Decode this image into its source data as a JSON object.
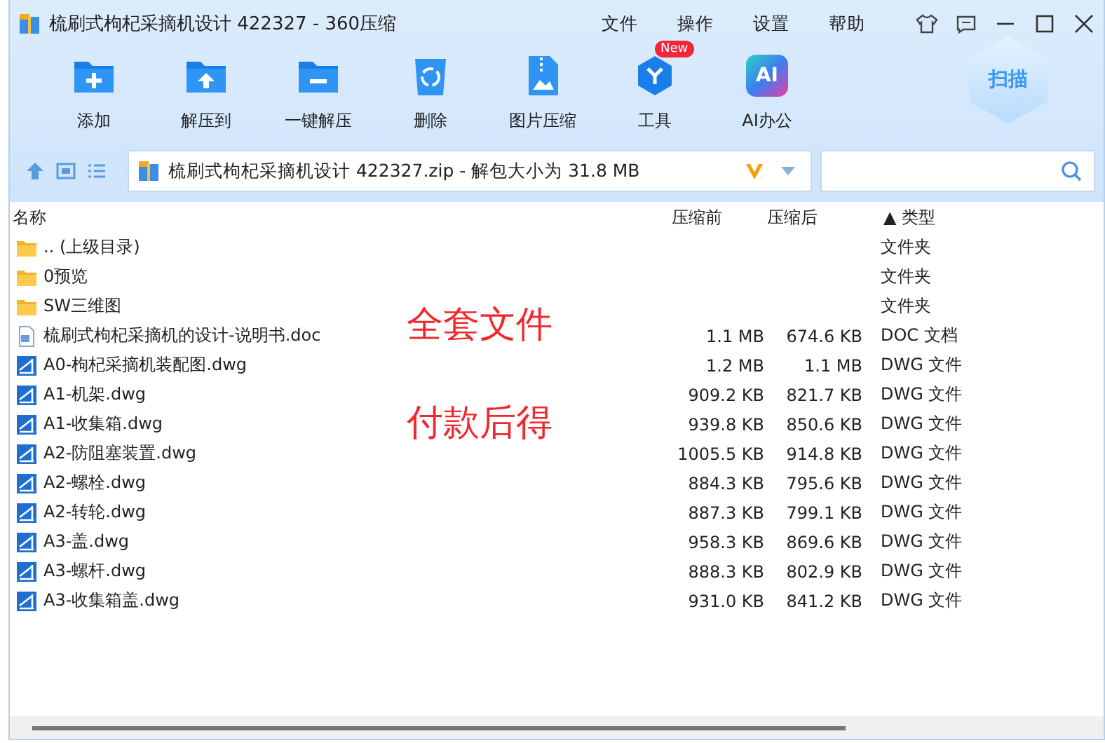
{
  "window": {
    "title": "梳刷式枸杞采摘机设计 422327 - 360压缩"
  },
  "menu": [
    "文件",
    "操作",
    "设置",
    "帮助"
  ],
  "toolbar": [
    {
      "label": "添加",
      "kind": "add"
    },
    {
      "label": "解压到",
      "kind": "extract"
    },
    {
      "label": "一键解压",
      "kind": "oneclick"
    },
    {
      "label": "删除",
      "kind": "delete"
    },
    {
      "label": "图片压缩",
      "kind": "image"
    },
    {
      "label": "工具",
      "kind": "tools",
      "badge": "New"
    },
    {
      "label": "AI办公",
      "kind": "ai",
      "icon_text": "AI"
    }
  ],
  "scan_button": "扫描",
  "address": {
    "path": "梳刷式枸杞采摘机设计 422327.zip - 解包大小为 31.8 MB"
  },
  "table": {
    "columns": [
      {
        "label": "名称"
      },
      {
        "label": "压缩前"
      },
      {
        "label": "压缩后"
      },
      {
        "label": "类型",
        "sort_mark": "▲"
      }
    ],
    "rows": [
      {
        "kind": "folder",
        "name": ".. (上级目录)",
        "before": "",
        "after": "",
        "type": "文件夹"
      },
      {
        "kind": "folder",
        "name": "0预览",
        "before": "",
        "after": "",
        "type": "文件夹"
      },
      {
        "kind": "folder",
        "name": "SW三维图",
        "before": "",
        "after": "",
        "type": "文件夹"
      },
      {
        "kind": "doc",
        "name": "梳刷式枸杞采摘机的设计-说明书.doc",
        "before": "1.1 MB",
        "after": "674.6 KB",
        "type": "DOC 文档"
      },
      {
        "kind": "dwg",
        "name": "A0-枸杞采摘机装配图.dwg",
        "before": "1.2 MB",
        "after": "1.1 MB",
        "type": "DWG 文件"
      },
      {
        "kind": "dwg",
        "name": "A1-机架.dwg",
        "before": "909.2 KB",
        "after": "821.7 KB",
        "type": "DWG 文件"
      },
      {
        "kind": "dwg",
        "name": "A1-收集箱.dwg",
        "before": "939.8 KB",
        "after": "850.6 KB",
        "type": "DWG 文件"
      },
      {
        "kind": "dwg",
        "name": "A2-防阻塞装置.dwg",
        "before": "1005.5 KB",
        "after": "914.8 KB",
        "type": "DWG 文件"
      },
      {
        "kind": "dwg",
        "name": "A2-螺栓.dwg",
        "before": "884.3 KB",
        "after": "795.6 KB",
        "type": "DWG 文件"
      },
      {
        "kind": "dwg",
        "name": "A2-转轮.dwg",
        "before": "887.3 KB",
        "after": "799.1 KB",
        "type": "DWG 文件"
      },
      {
        "kind": "dwg",
        "name": "A3-盖.dwg",
        "before": "958.3 KB",
        "after": "869.6 KB",
        "type": "DWG 文件"
      },
      {
        "kind": "dwg",
        "name": "A3-螺杆.dwg",
        "before": "888.3 KB",
        "after": "802.9 KB",
        "type": "DWG 文件"
      },
      {
        "kind": "dwg",
        "name": "A3-收集箱盖.dwg",
        "before": "931.0 KB",
        "after": "841.2 KB",
        "type": "DWG 文件"
      }
    ]
  },
  "overlay_texts": [
    "全套文件",
    "付款后得"
  ]
}
